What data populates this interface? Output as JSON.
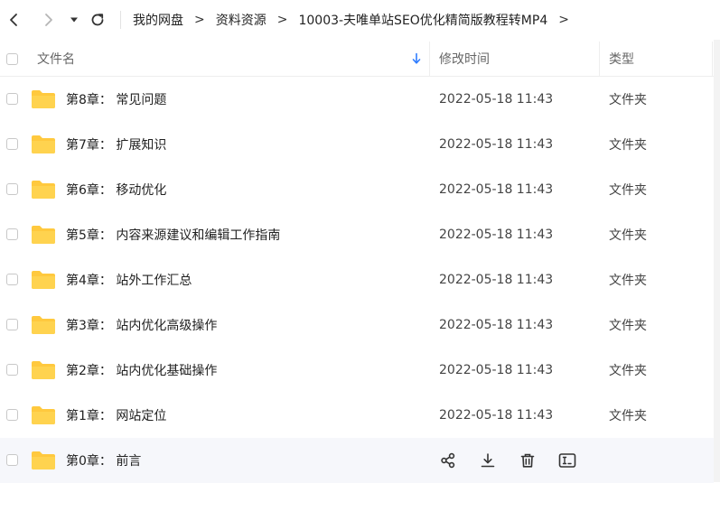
{
  "breadcrumb": [
    "我的网盘",
    "资料资源",
    "10003-夫唯单站SEO优化精简版教程转MP4"
  ],
  "breadcrumb_sep": ">",
  "columns": {
    "name": "文件名",
    "modified": "修改时间",
    "type": "类型"
  },
  "files": [
    {
      "name": "第8章：  常见问题",
      "modified": "2022-05-18 11:43",
      "type": "文件夹"
    },
    {
      "name": "第7章：  扩展知识",
      "modified": "2022-05-18 11:43",
      "type": "文件夹"
    },
    {
      "name": "第6章：  移动优化",
      "modified": "2022-05-18 11:43",
      "type": "文件夹"
    },
    {
      "name": "第5章：  内容来源建议和编辑工作指南",
      "modified": "2022-05-18 11:43",
      "type": "文件夹"
    },
    {
      "name": "第4章：  站外工作汇总",
      "modified": "2022-05-18 11:43",
      "type": "文件夹"
    },
    {
      "name": "第3章：  站内优化高级操作",
      "modified": "2022-05-18 11:43",
      "type": "文件夹"
    },
    {
      "name": "第2章：  站内优化基础操作",
      "modified": "2022-05-18 11:43",
      "type": "文件夹"
    },
    {
      "name": "第1章：  网站定位",
      "modified": "2022-05-18 11:43",
      "type": "文件夹"
    },
    {
      "name": "第0章：  前言",
      "modified": "",
      "type": ""
    }
  ],
  "colors": {
    "folder": "#ffc93e",
    "folder_dark": "#f5b82a",
    "sort_arrow": "#2f7dff",
    "hover_row": "#f6f7fb"
  },
  "icons": [
    "back-icon",
    "forward-icon",
    "dropdown-icon",
    "refresh-icon",
    "share-icon",
    "download-icon",
    "trash-icon",
    "rename-icon"
  ]
}
